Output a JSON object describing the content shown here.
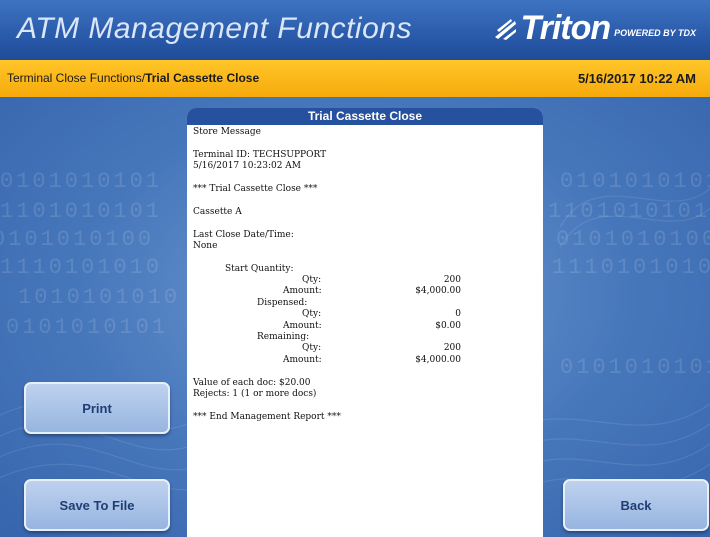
{
  "header": {
    "app_title": "ATM Management Functions",
    "brand_name": "Triton",
    "brand_tagline": "POWERED BY TDX"
  },
  "crumbbar": {
    "breadcrumb_path": "Terminal Close Functions/",
    "breadcrumb_current": "Trial Cassette Close",
    "datetime": "5/16/2017  10:22 AM"
  },
  "buttons": {
    "print": "Print",
    "save_to_file": "Save To File",
    "back": "Back"
  },
  "report": {
    "title": "Trial Cassette Close",
    "store_message": "Store Message",
    "terminal_id": "Terminal ID: TECHSUPPORT",
    "timestamp": "5/16/2017 10:23:02 AM",
    "section_header": "*** Trial Cassette Close ***",
    "cassette": "Cassette A",
    "last_close_label": "Last Close Date/Time:",
    "last_close_value": "None",
    "start_quantity_label": "Start Quantity:",
    "start_qty_label": "Qty:",
    "start_qty_value": "200",
    "start_amount_label": "Amount:",
    "start_amount_value": "$4,000.00",
    "dispensed_label": "Dispensed:",
    "dispensed_qty_label": "Qty:",
    "dispensed_qty_value": "0",
    "dispensed_amount_label": "Amount:",
    "dispensed_amount_value": "$0.00",
    "remaining_label": "Remaining:",
    "remaining_qty_label": "Qty:",
    "remaining_qty_value": "200",
    "remaining_amount_label": "Amount:",
    "remaining_amount_value": "$4,000.00",
    "doc_value": "Value of each doc: $20.00",
    "rejects": "Rejects: 1 (1 or more docs)",
    "footer": "*** End Management Report ***"
  },
  "background": {
    "binary_rows": [
      "0101010101",
      "1101010101",
      "0101010100",
      "1110101010",
      "1010101010",
      "0101010101"
    ]
  },
  "colors": {
    "header_blue": "#2756a6",
    "crumb_gold": "#f6aa0b",
    "button_face": "#a9c3e7",
    "button_text": "#1f3e73",
    "panel_title": "#26519e"
  }
}
